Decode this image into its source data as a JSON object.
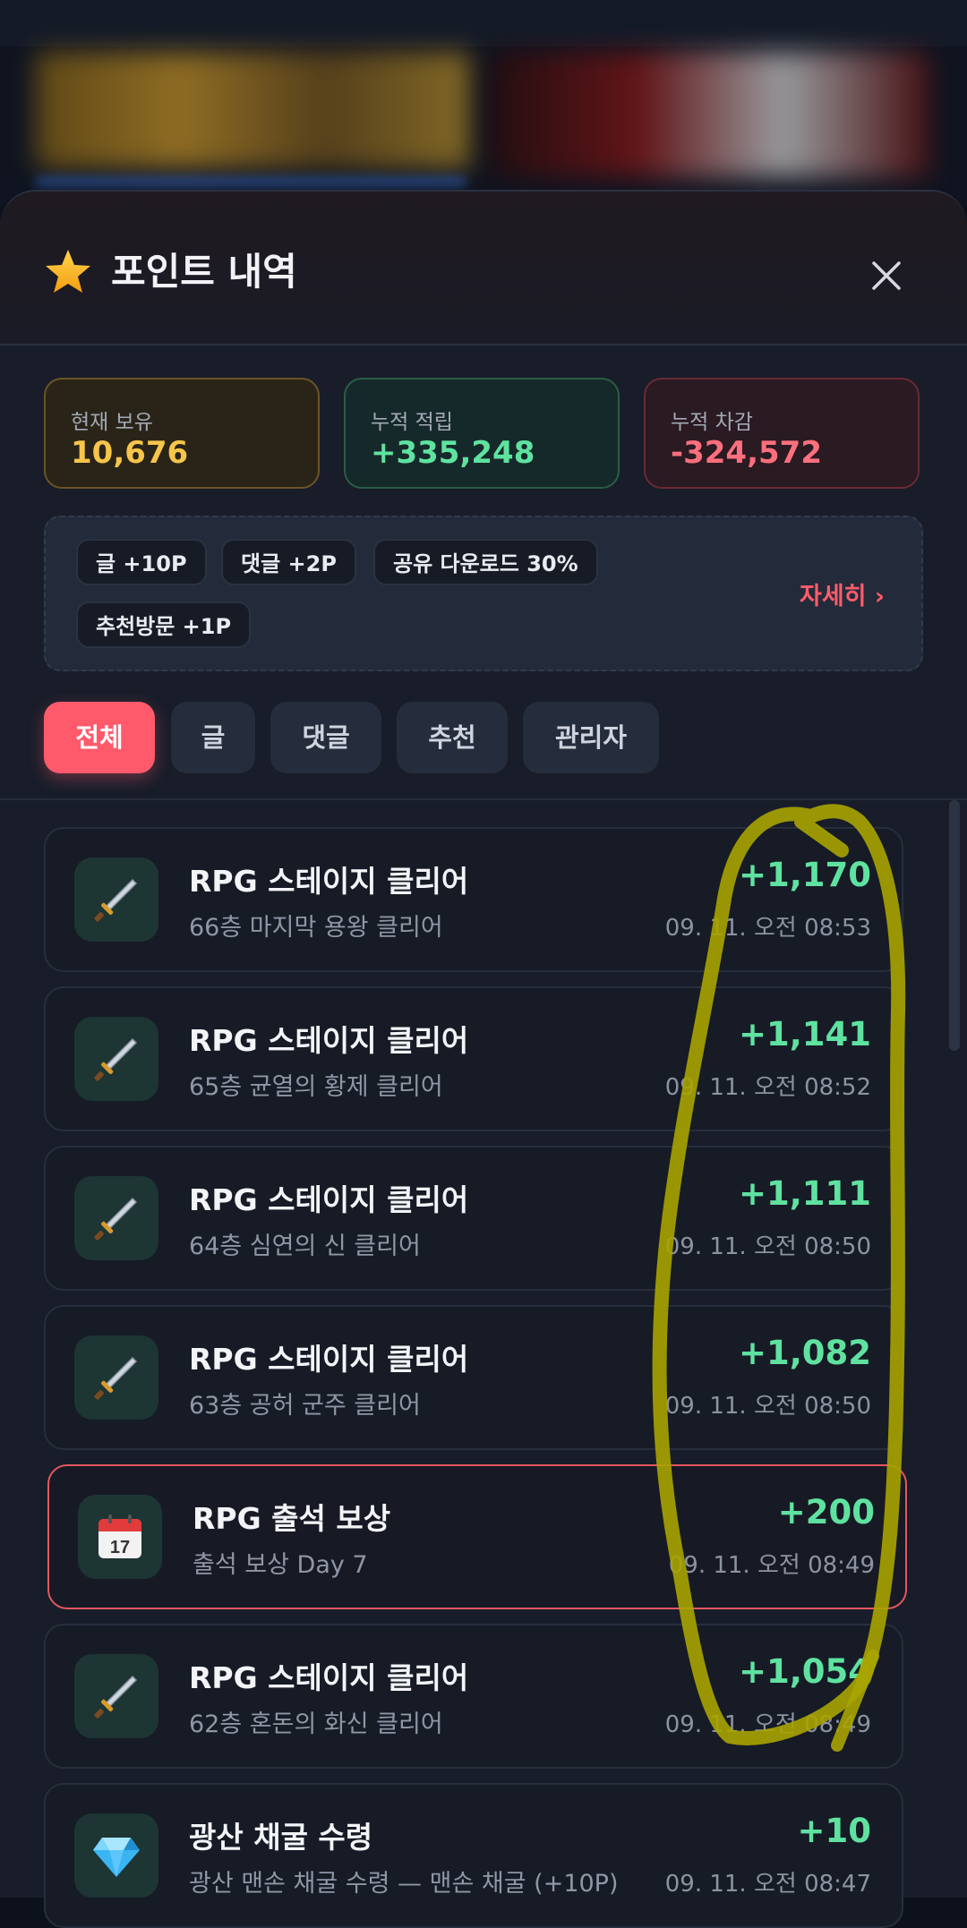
{
  "header": {
    "title": "포인트 내역"
  },
  "stats": [
    {
      "label": "현재 보유",
      "value": "10,676"
    },
    {
      "label": "누적 적립",
      "value": "+335,248"
    },
    {
      "label": "누적 차감",
      "value": "-324,572"
    }
  ],
  "rules": {
    "chips": [
      "글 +10P",
      "댓글 +2P",
      "공유 다운로드 30%",
      "추천방문 +1P"
    ],
    "detail_label": "자세히 ›"
  },
  "tabs": [
    "전체",
    "글",
    "댓글",
    "추천",
    "관리자"
  ],
  "active_tab": "전체",
  "items": [
    {
      "icon": "sword-icon",
      "title": "RPG 스테이지 클리어",
      "desc": "66층 마지막 용왕 클리어",
      "amount": "+1,170",
      "time": "09. 11. 오전 08:53"
    },
    {
      "icon": "sword-icon",
      "title": "RPG 스테이지 클리어",
      "desc": "65층 균열의 황제 클리어",
      "amount": "+1,141",
      "time": "09. 11. 오전 08:52"
    },
    {
      "icon": "sword-icon",
      "title": "RPG 스테이지 클리어",
      "desc": "64층 심연의 신 클리어",
      "amount": "+1,111",
      "time": "09. 11. 오전 08:50"
    },
    {
      "icon": "sword-icon",
      "title": "RPG 스테이지 클리어",
      "desc": "63층 공허 군주 클리어",
      "amount": "+1,082",
      "time": "09. 11. 오전 08:50"
    },
    {
      "icon": "calendar-icon",
      "title": "RPG 출석 보상",
      "desc": "출석 보상 Day 7",
      "amount": "+200",
      "time": "09. 11. 오전 08:49",
      "calendar_day": "17",
      "highlighted": true
    },
    {
      "icon": "sword-icon",
      "title": "RPG 스테이지 클리어",
      "desc": "62층 혼돈의 화신 클리어",
      "amount": "+1,054",
      "time": "09. 11. 오전 08:49"
    },
    {
      "icon": "diamond-icon",
      "title": "광산 채굴 수령",
      "desc": "광산 맨손 채굴 수령 — 맨손 채굴 (+10P)",
      "amount": "+10",
      "time": "09. 11. 오전 08:47"
    }
  ],
  "colors": {
    "accent": "#ff5a6c",
    "positive": "#5fe2a0",
    "negative": "#ff6f7d",
    "gold": "#f6c54a",
    "annotation": "#a8a400"
  }
}
